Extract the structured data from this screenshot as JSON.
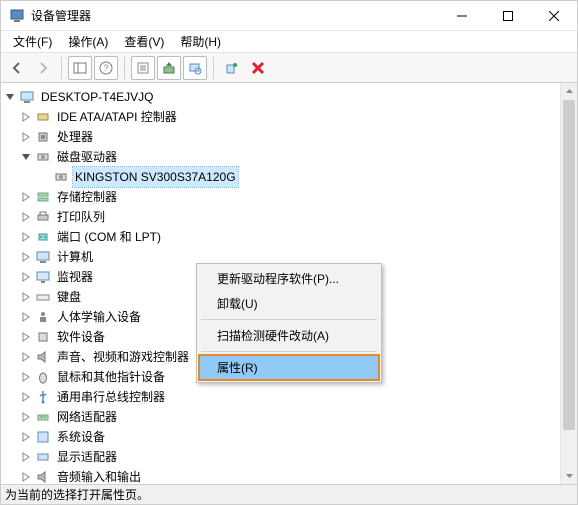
{
  "window": {
    "title": "设备管理器"
  },
  "menubar": {
    "file": "文件(F)",
    "action": "操作(A)",
    "view": "查看(V)",
    "help": "帮助(H)"
  },
  "tree": {
    "root": "DESKTOP-T4EJVJQ",
    "ide": "IDE ATA/ATAPI 控制器",
    "cpu": "处理器",
    "disk_drives": "磁盘驱动器",
    "kingston": "KINGSTON SV300S37A120G",
    "storage": "存储控制器",
    "print": "打印队列",
    "ports": "端口 (COM 和 LPT)",
    "computer": "计算机",
    "monitor": "监视器",
    "keyboard": "键盘",
    "hid": "人体学输入设备",
    "software_devices": "软件设备",
    "audio_video_game": "声音、视频和游戏控制器",
    "mouse": "鼠标和其他指针设备",
    "usb": "通用串行总线控制器",
    "network": "网络适配器",
    "system": "系统设备",
    "display": "显示适配器",
    "audio_io": "音频输入和输出"
  },
  "contextmenu": {
    "update_driver": "更新驱动程序软件(P)...",
    "uninstall": "卸载(U)",
    "scan_hardware": "扫描检测硬件改动(A)",
    "properties": "属性(R)"
  },
  "statusbar": {
    "text": "为当前的选择打开属性页。"
  }
}
